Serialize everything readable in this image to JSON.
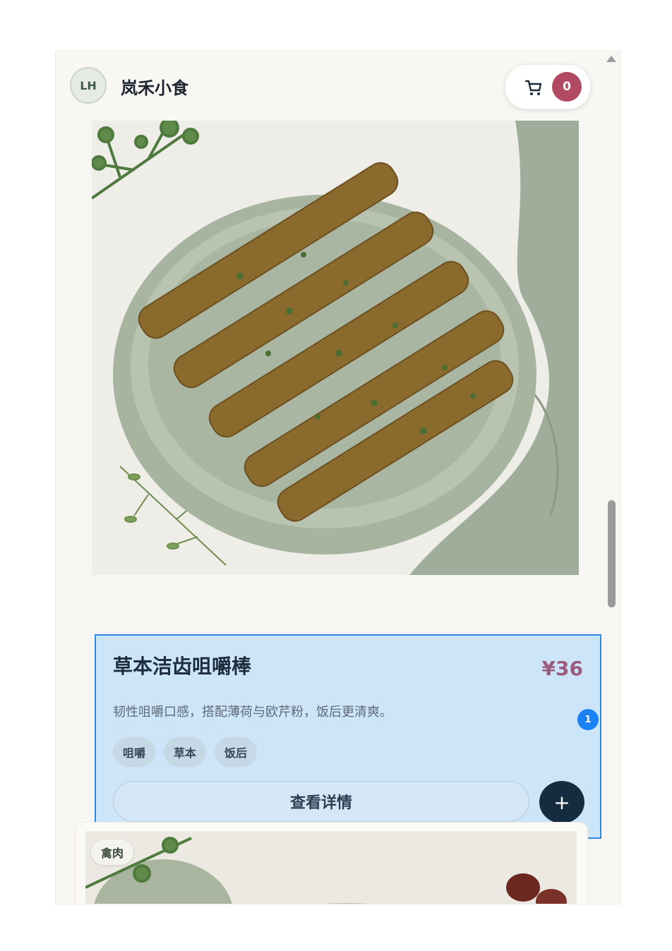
{
  "header": {
    "avatar_initials": "LH",
    "brand_name": "岚禾小食",
    "cart_count": "0"
  },
  "product": {
    "name": "草本洁齿咀嚼棒",
    "price": "¥36",
    "description": "韧性咀嚼口感，搭配薄荷与欧芹粉，饭后更清爽。",
    "tags": [
      "咀嚼",
      "草本",
      "饭后"
    ],
    "detail_button": "查看详情",
    "add_button": "+",
    "note_badge": "1"
  },
  "next_product": {
    "category": "禽肉"
  },
  "colors": {
    "accent_price": "#9c5a7d",
    "cart_badge": "#b24a63",
    "selection_border": "#2d88e0",
    "selection_fill": "#cde5f8",
    "dark_button": "#142b40"
  },
  "icons": [
    "cart-icon",
    "plus-icon",
    "scroll-up-arrow-icon"
  ]
}
